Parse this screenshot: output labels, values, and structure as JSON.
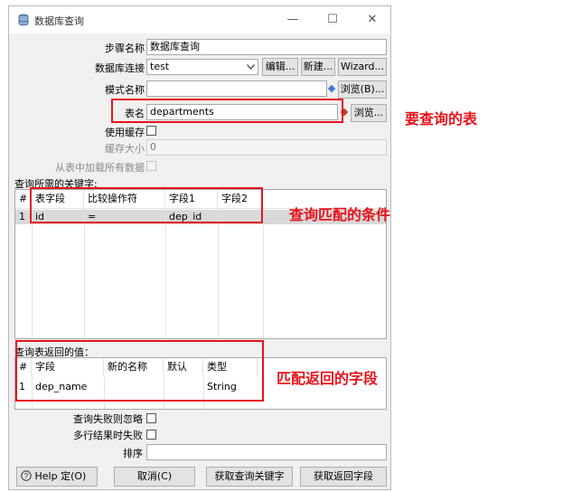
{
  "window": {
    "title": "数据库查询",
    "minimize": "—",
    "maximize": "☐",
    "close": "✕"
  },
  "form": {
    "step_name_label": "步骤名称",
    "step_name_value": "数据库查询",
    "db_conn_label": "数据库连接",
    "db_conn_value": "test",
    "edit_button": "编辑...",
    "new_button": "新建...",
    "wizard_button": "Wizard...",
    "schema_label": "模式名称",
    "schema_value": "",
    "browse_schema_button": "浏览(B)...",
    "table_label": "表名",
    "table_value": "departments",
    "browse_table_button": "浏览...",
    "use_cache_label": "使用缓存",
    "cache_size_label": "缓存大小",
    "cache_size_value": "0",
    "load_all_label": "从表中加载所有数据"
  },
  "keys_section": {
    "label": "查询所需的关键字:",
    "columns": [
      "#",
      "表字段",
      "比较操作符",
      "字段1",
      "字段2"
    ],
    "rows": [
      {
        "num": "1",
        "table_field": "id",
        "operator": "=",
        "field1": "dep_id",
        "field2": ""
      }
    ]
  },
  "return_section": {
    "label": "查询表返回的值：",
    "columns": [
      "#",
      "字段",
      "新的名称",
      "默认",
      "类型"
    ],
    "rows": [
      {
        "num": "1",
        "field": "dep_name",
        "new_name": "",
        "default": "",
        "type": "String"
      }
    ]
  },
  "options": {
    "fail_ignore_label": "查询失败则忽略",
    "multi_fail_label": "多行结果时失败",
    "order_label": "排序",
    "order_value": ""
  },
  "buttons": {
    "help": "Help",
    "ok": "定(O)",
    "cancel": "取消(C)",
    "get_keys": "获取查询关键字",
    "get_fields": "获取返回字段"
  },
  "annotations": {
    "table_note": "要查询的表",
    "condition_note": "查询匹配的条件",
    "return_note": "匹配返回的字段"
  },
  "colors": {
    "annotation_red": "#e8131b",
    "row_highlight": "#d9d9d9",
    "diamond_blue": "#3a7bd5",
    "diamond_red": "#c0392b"
  }
}
